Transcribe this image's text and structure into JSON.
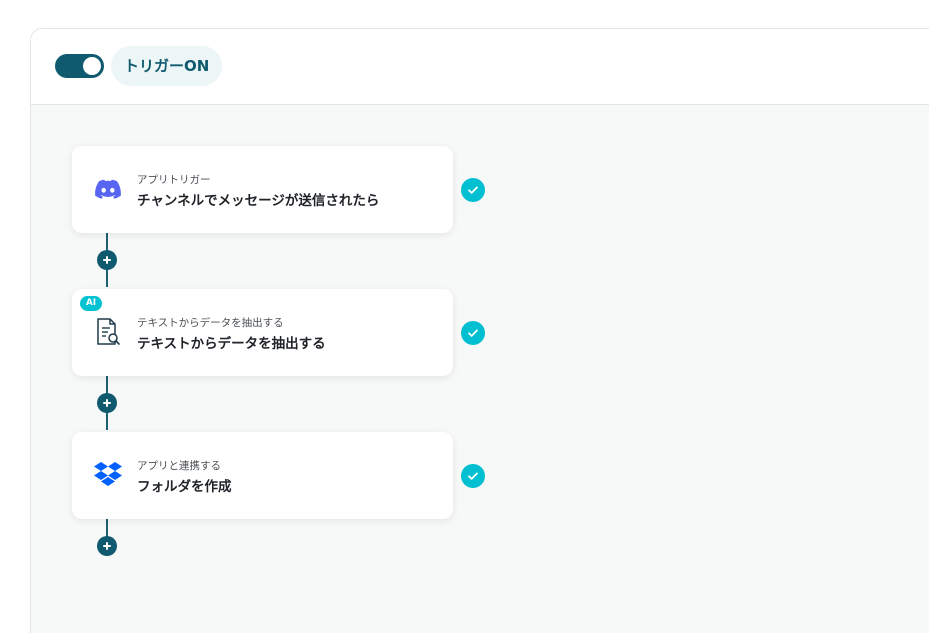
{
  "header": {
    "trigger_toggle_state": "on",
    "trigger_label": "トリガーON"
  },
  "flow": {
    "steps": [
      {
        "subtitle": "アプリトリガー",
        "title": "チャンネルでメッセージが送信されたら",
        "icon": "discord-icon",
        "status": "completed"
      },
      {
        "badge": "AI",
        "subtitle": "テキストからデータを抽出する",
        "title": "テキストからデータを抽出する",
        "icon": "document-search-icon",
        "status": "completed"
      },
      {
        "subtitle": "アプリと連携する",
        "title": "フォルダを作成",
        "icon": "dropbox-icon",
        "status": "completed"
      }
    ]
  },
  "colors": {
    "primary": "#0f5a6e",
    "accent": "#00bfd0",
    "discord": "#5865f2",
    "dropbox": "#0061fe"
  }
}
